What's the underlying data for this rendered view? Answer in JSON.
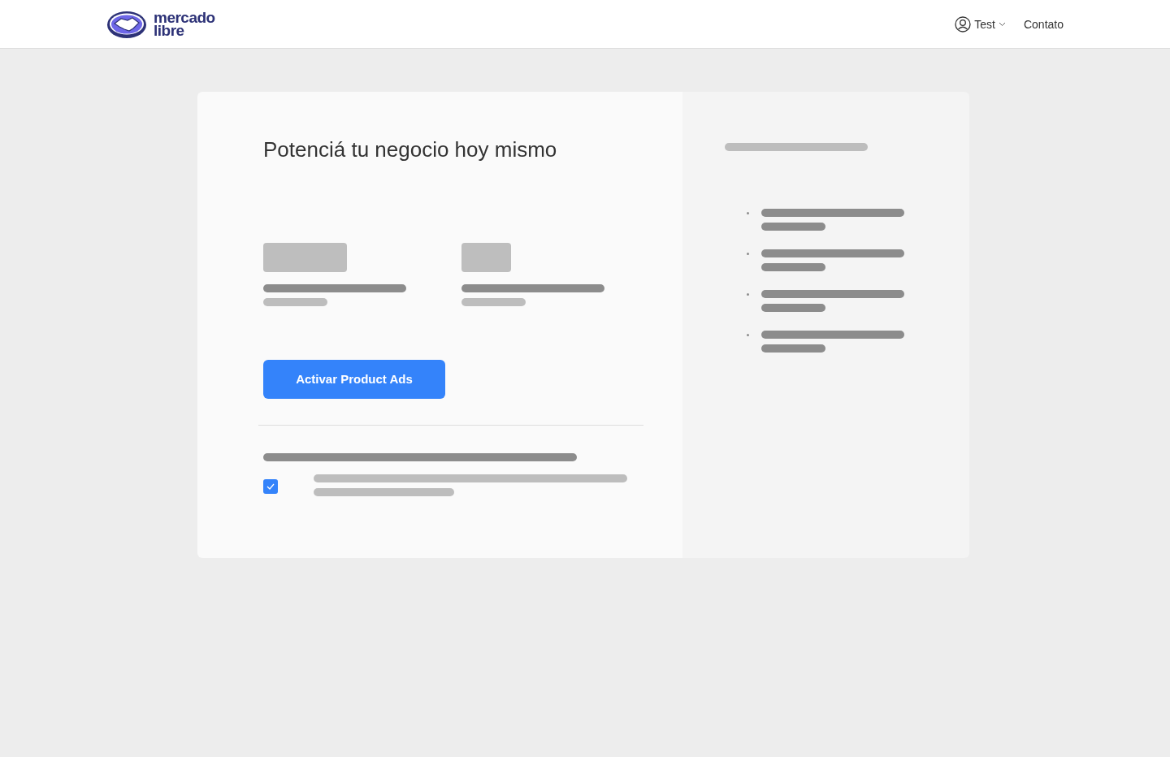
{
  "header": {
    "logo": {
      "line_1": "mercado",
      "line_2": "libre"
    },
    "user_menu": {
      "label": "Test"
    },
    "contact_link": "Contato"
  },
  "main": {
    "title": "Potenciá tu negocio hoy mismo",
    "button": "Activar Product Ads",
    "checkbox": {
      "checked": true
    }
  }
}
